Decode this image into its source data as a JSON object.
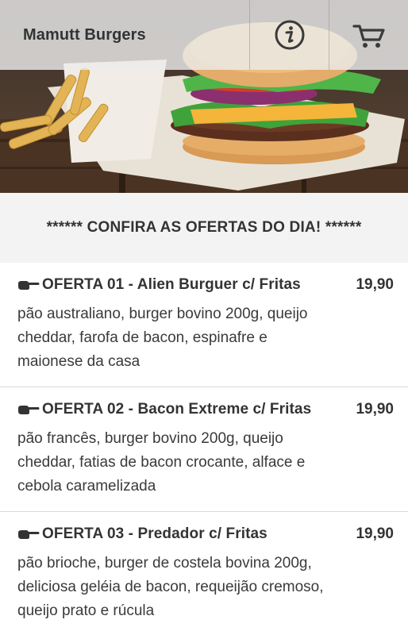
{
  "app": {
    "title": "Mamutt Burgers"
  },
  "header": {
    "info_icon": "info-circle-icon",
    "cart_icon": "shopping-cart-icon"
  },
  "hero": {
    "image": "burger-and-fries-photo"
  },
  "banner": {
    "text": "****** CONFIRA AS OFERTAS DO DIA! ******"
  },
  "offers": [
    {
      "title": "OFERTA 01 - Alien Burguer c/ Fritas",
      "price": "19,90",
      "description": "pão australiano, burger bovino 200g, queijo cheddar, farofa de bacon, espinafre e maionese da casa",
      "icon": "pointing-hand-icon"
    },
    {
      "title": "OFERTA 02 - Bacon Extreme c/ Fritas",
      "price": "19,90",
      "description": "pão francês, burger bovino 200g, queijo cheddar, fatias de bacon crocante, alface e cebola caramelizada",
      "icon": "pointing-hand-icon"
    },
    {
      "title": "OFERTA 03 - Predador c/ Fritas",
      "price": "19,90",
      "description": "pão brioche, burger de costela bovina 200g, deliciosa geléia de bacon, requeijão cremoso, queijo prato e rúcula",
      "icon": "pointing-hand-icon"
    }
  ],
  "colors": {
    "text": "#333333",
    "banner_bg": "#f3f3f3",
    "divider": "#d9d9d9",
    "topbar_bg": "#ebebeb"
  }
}
